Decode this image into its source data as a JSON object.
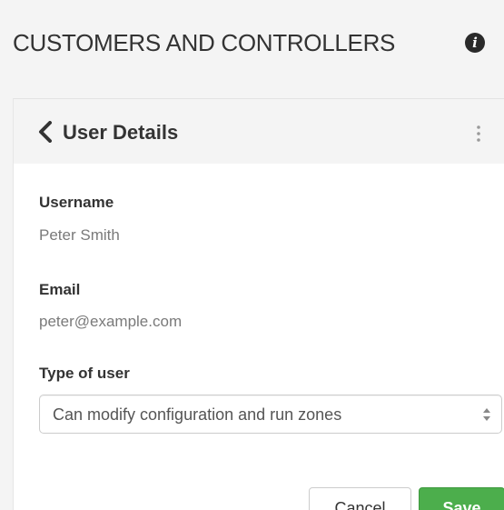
{
  "header": {
    "title": "CUSTOMERS AND CONTROLLERS",
    "info_icon": "info-circle-icon"
  },
  "panel": {
    "title": "User Details",
    "back_icon": "chevron-left-icon",
    "menu_icon": "kebab-menu-icon"
  },
  "fields": {
    "username": {
      "label": "Username",
      "value": "Peter Smith"
    },
    "email": {
      "label": "Email",
      "value": "peter@example.com"
    },
    "user_type": {
      "label": "Type of user",
      "selected": "Can modify configuration and run zones"
    }
  },
  "actions": {
    "cancel_label": "Cancel",
    "save_label": "Save"
  },
  "colors": {
    "save_button": "#4cae4c",
    "page_background": "#f4f4f4",
    "panel_background": "#ffffff"
  }
}
